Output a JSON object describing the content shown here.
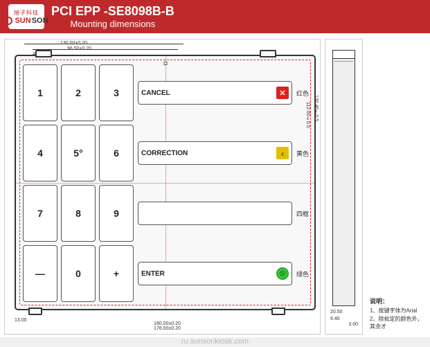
{
  "header": {
    "title": "PCI EPP -SE8098B-B",
    "subtitle": "Mounting dimensions",
    "logo_chinese": "旭子科技",
    "logo_sun": "SUN",
    "logo_son": "SON"
  },
  "drawing": {
    "dimensions": {
      "top1": "130.00±0.20",
      "top2": "96.50±0.20",
      "top3": "43.12",
      "bottom1": "160.00±0.20",
      "bottom2": "176.00±0.20",
      "bottom3": "13.00",
      "right1": "130.40±0.5",
      "right2": "112.60±0.5",
      "side1": "20.50",
      "side2": "6.40",
      "side3": "3.00"
    }
  },
  "keypad": {
    "num_keys": [
      {
        "label": "1",
        "row": 0,
        "col": 0
      },
      {
        "label": "2",
        "row": 0,
        "col": 1
      },
      {
        "label": "3",
        "row": 0,
        "col": 2
      },
      {
        "label": "4",
        "row": 1,
        "col": 0
      },
      {
        "label": "5°",
        "row": 1,
        "col": 1
      },
      {
        "label": "6",
        "row": 1,
        "col": 2
      },
      {
        "label": "7",
        "row": 2,
        "col": 0
      },
      {
        "label": "8",
        "row": 2,
        "col": 1
      },
      {
        "label": "9",
        "row": 2,
        "col": 2
      },
      {
        "label": "—",
        "row": 3,
        "col": 0
      },
      {
        "label": "0",
        "row": 3,
        "col": 1
      },
      {
        "label": "+",
        "row": 3,
        "col": 2
      }
    ],
    "func_keys": [
      {
        "id": "cancel",
        "label": "CANCEL",
        "color_label": "红色",
        "icon_type": "cancel"
      },
      {
        "id": "correction",
        "label": "CORRECTION",
        "color_label": "黄色",
        "icon_type": "correction"
      },
      {
        "id": "blank",
        "label": "",
        "color_label": "四框",
        "icon_type": "blank"
      },
      {
        "id": "enter",
        "label": "ENTER",
        "color_label": "绿色",
        "icon_type": "enter"
      }
    ]
  },
  "notes": {
    "title": "说明：",
    "items": [
      "1、按键字体为Arial",
      "2、除批定的颜色外，其余才"
    ]
  },
  "watermark": "ru.sunsonkiosk.com"
}
